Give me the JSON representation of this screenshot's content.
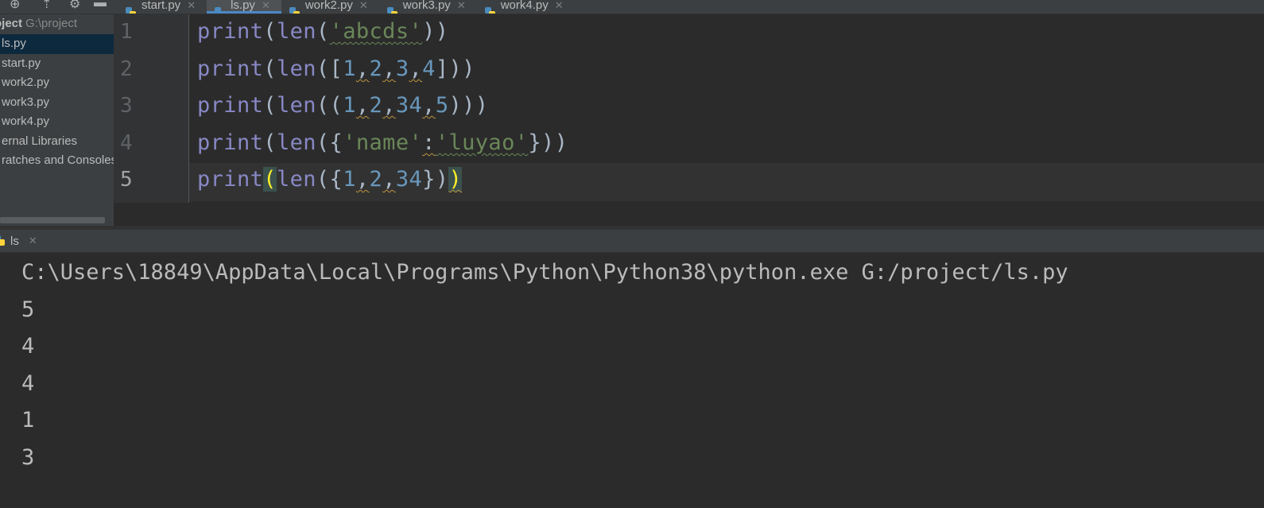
{
  "tabs": [
    {
      "label": "start.py",
      "active": false
    },
    {
      "label": "ls.py",
      "active": true
    },
    {
      "label": "work2.py",
      "active": false
    },
    {
      "label": "work3.py",
      "active": false
    },
    {
      "label": "work4.py",
      "active": false
    }
  ],
  "project": {
    "title": "oject",
    "path": "G:\\project",
    "items": [
      "ls.py",
      "start.py",
      "work2.py",
      "work3.py",
      "work4.py",
      "ernal Libraries",
      "ratches and Consoles"
    ]
  },
  "editor": {
    "line_numbers": [
      "1",
      "2",
      "3",
      "4",
      "5"
    ],
    "current_line": 5
  },
  "run": {
    "tab_label": "ls",
    "command": "C:\\Users\\18849\\AppData\\Local\\Programs\\Python\\Python38\\python.exe G:/project/ls.py",
    "output": [
      "5",
      "4",
      "4",
      "1",
      "3"
    ]
  },
  "icons": {
    "toolbar": [
      "target-icon",
      "collapse-icon",
      "gear-icon",
      "minimize-icon"
    ],
    "file": "python-file-icon",
    "close": "close-icon"
  },
  "colors": {
    "keyword": "#8888c6",
    "string": "#6a8759",
    "number": "#6897bb",
    "brace_match": "#ffef28",
    "selection": "#0d293e"
  }
}
